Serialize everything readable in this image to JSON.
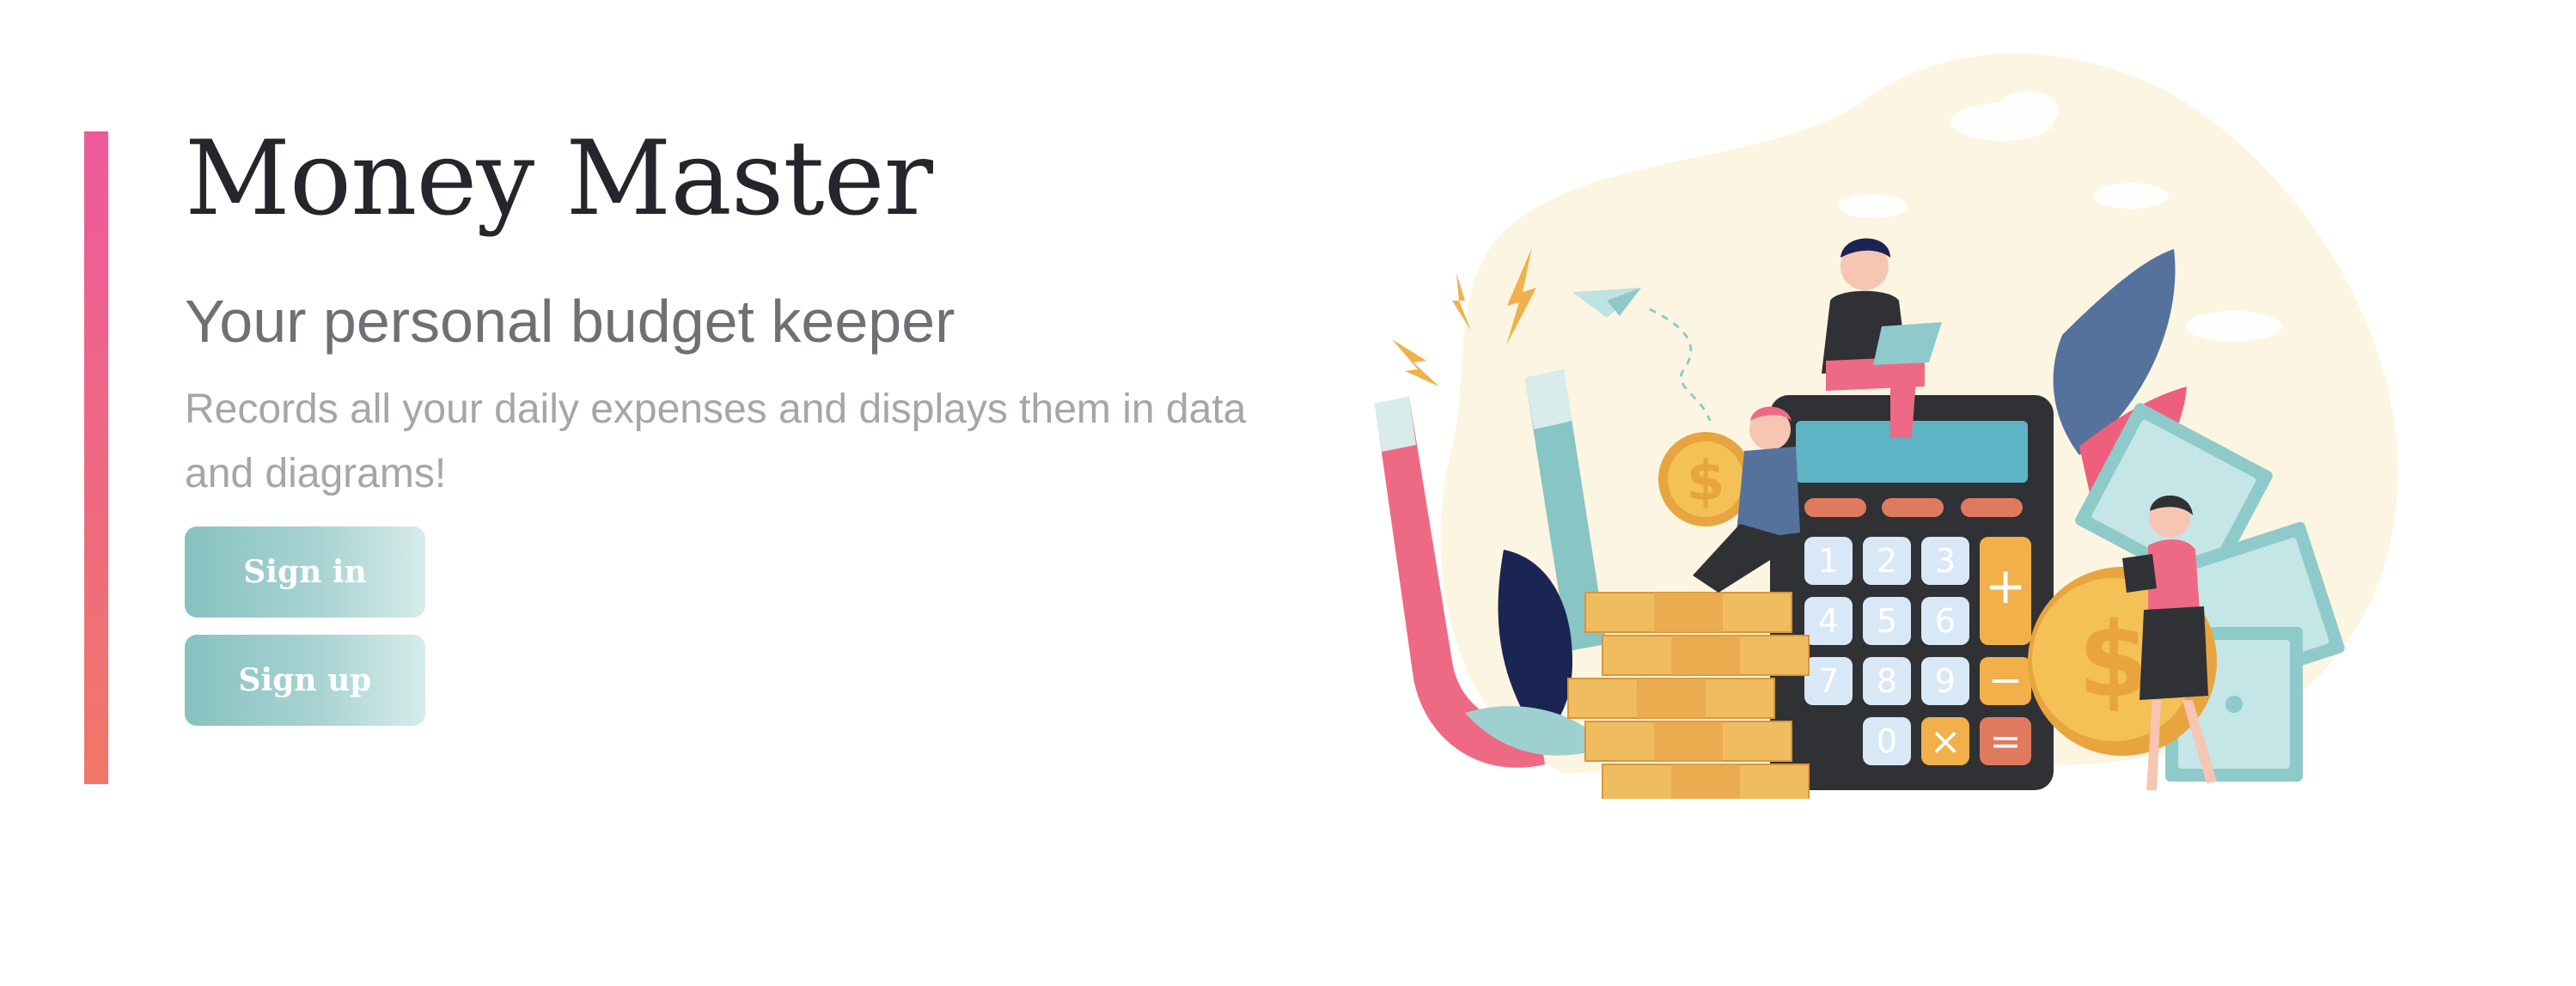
{
  "hero": {
    "title": "Money Master",
    "subtitle": "Your personal budget keeper",
    "description": "Records all your daily expenses and displays them in data and diagrams!"
  },
  "actions": {
    "sign_in_label": "Sign in",
    "sign_up_label": "Sign up"
  },
  "illustration": {
    "calculator_keys": [
      "1",
      "2",
      "3",
      "+",
      "4",
      "5",
      "6",
      "7",
      "8",
      "9",
      "−",
      "0",
      "×",
      "="
    ],
    "coin_symbol": "$"
  },
  "colors": {
    "accent_bar_top": "#ee5a9c",
    "accent_bar_bottom": "#f07868",
    "button_gradient_start": "#87c1c1",
    "button_gradient_end": "#d6ecea",
    "title_color": "#24262b",
    "subtitle_color": "#6e7073",
    "description_color": "#a4a6a9"
  },
  "icons": [
    "magnet-icon",
    "calculator-icon",
    "coin-stack-icon",
    "paper-plane-icon",
    "lightning-icon",
    "banknote-icon",
    "leaf-icon"
  ]
}
